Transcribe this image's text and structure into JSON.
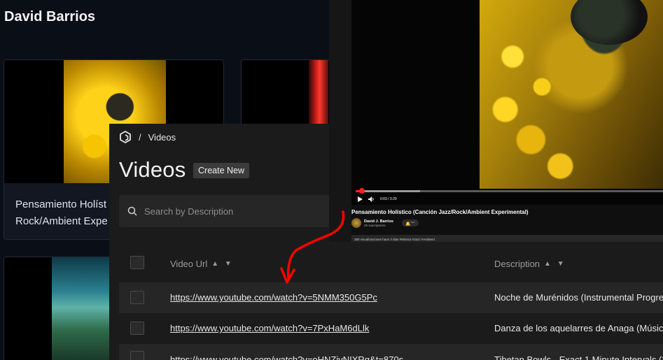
{
  "background_page": {
    "title": "David Barrios",
    "cards": [
      {
        "text": "Pensamiento Holíst\nRock/Ambient Expe"
      },
      {
        "text": ""
      },
      {
        "text": ""
      }
    ]
  },
  "admin": {
    "breadcrumb": {
      "separator": "/",
      "current": "Videos"
    },
    "title": "Videos",
    "create_label": "Create New",
    "search": {
      "placeholder": "Search by Description",
      "value": ""
    },
    "columns": [
      {
        "label": "Video Url",
        "sort": "▲ ▼"
      },
      {
        "label": "Description",
        "sort": "▲ ▼"
      }
    ],
    "rows": [
      {
        "url": "https://www.youtube.com/watch?v=5NMM350G5Pc",
        "description": "Noche de Murénidos (Instrumental Progre"
      },
      {
        "url": "https://www.youtube.com/watch?v=7PxHaM6dLlk",
        "description": "Danza de los aquelarres de Anaga (Música"
      },
      {
        "url": "https://www.youtube.com/watch?v=oHNZivNIXRg&t=870s",
        "description": "Tibetan Bowls - Exact 1 Minute Intervals (20"
      }
    ]
  },
  "youtube": {
    "time": "0:03 / 3:20",
    "progress": 0.02,
    "buffered": 0.21,
    "video_title": "Pensamiento Holístico (Canción Jazz/Rock/Ambient Experimental)",
    "channel_name": "David J. Barrios",
    "subscribers": "25 suscriptores",
    "description_line": "280 visualizaciones hace 3 días  #Música  #Jazz  #Ambient"
  },
  "colors": {
    "admin_bg": "#1b1b1b",
    "page_bg": "#0a0e16",
    "annotation": "#ff0000",
    "progress": "#ff1f1f"
  },
  "icons": [
    "app-logo-icon",
    "search-icon",
    "play-icon",
    "volume-icon",
    "bell-icon",
    "red-annotation-arrow"
  ]
}
